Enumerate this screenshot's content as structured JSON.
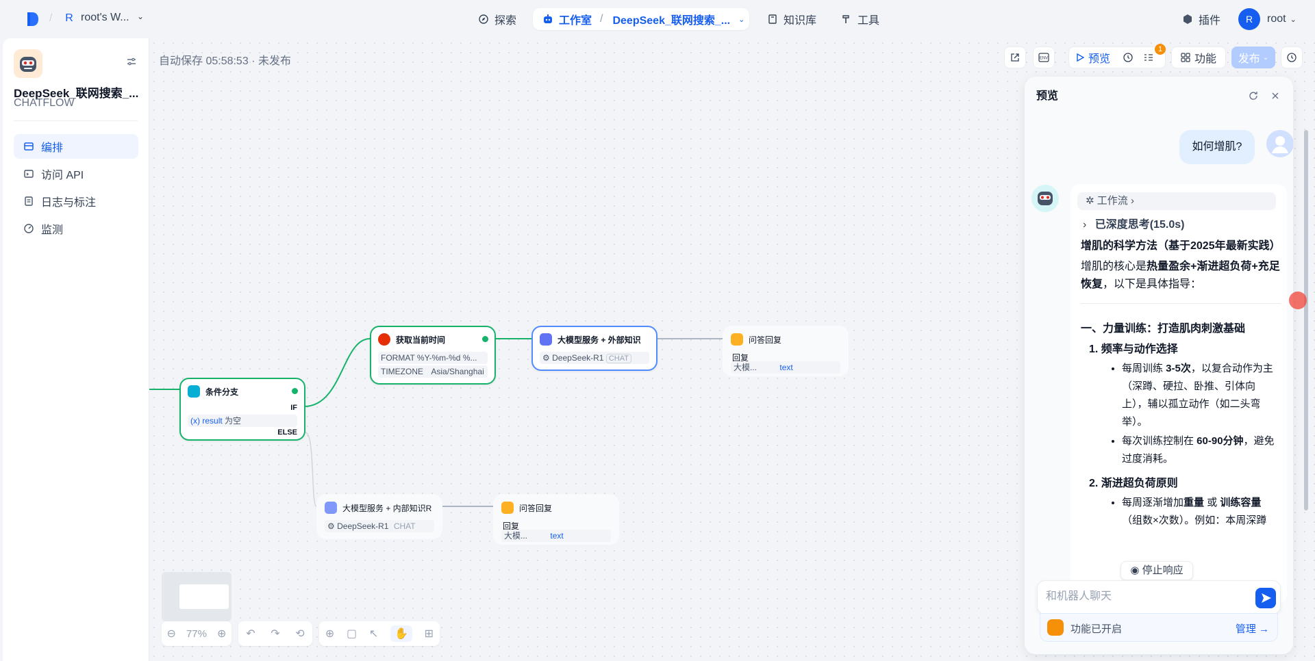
{
  "header": {
    "workspace_initial": "R",
    "workspace_name": "root's W...",
    "nav": {
      "explore": "探索",
      "studio": "工作室",
      "app_name": "DeepSeek_联网搜索_...",
      "knowledge": "知识库",
      "tools": "工具"
    },
    "plugins": "插件",
    "user_initial": "R",
    "user_name": "root"
  },
  "sidebar": {
    "app_name": "DeepSeek_联网搜索_...",
    "app_type": "CHATFLOW",
    "items": [
      {
        "label": "编排",
        "icon": "layout-icon",
        "active": true
      },
      {
        "label": "访问 API",
        "icon": "terminal-icon",
        "active": false
      },
      {
        "label": "日志与标注",
        "icon": "file-list-icon",
        "active": false
      },
      {
        "label": "监测",
        "icon": "dashboard-icon",
        "active": false
      }
    ]
  },
  "canvas": {
    "autosave": "自动保存 05:58:53 · 未发布",
    "toolbar": {
      "preview": "预览",
      "features": "功能",
      "publish": "发布",
      "checklist_badge": "1"
    },
    "zoom": "77%",
    "nodes": {
      "if_else": {
        "title": "条件分支",
        "if_label": "IF",
        "var": "result",
        "op": "为空",
        "else_label": "ELSE"
      },
      "time": {
        "title": "获取当前时间",
        "format_key": "FORMAT",
        "format_val": "%Y-%m-%d %...",
        "tz_key": "TIMEZONE",
        "tz_val": "Asia/Shanghai"
      },
      "llm_ext": {
        "title": "大模型服务 + 外部知识",
        "model": "DeepSeek-R1",
        "mode": "CHAT"
      },
      "answer1": {
        "title": "问答回复",
        "label": "回复",
        "src": "大模...",
        "var": "text"
      },
      "llm_int": {
        "title": "大模型服务 + 内部知识R",
        "model": "DeepSeek-R1",
        "mode": "CHAT"
      },
      "answer2": {
        "title": "问答回复",
        "label": "回复",
        "src": "大模...",
        "var": "text"
      }
    }
  },
  "preview": {
    "title": "预览",
    "user_message": "如何增肌?",
    "workflow_label": "工作流",
    "thinking": "已深度思考(15.0s)",
    "heading": "增肌的科学方法（基于2025年最新实践）",
    "intro_prefix": "增肌的核心是",
    "intro_bold": "热量盈余+渐进超负荷+充足恢复",
    "intro_suffix": "，以下是具体指导：",
    "section1": "一、力量训练：打造肌肉刺激基础",
    "sub1": "1. 频率与动作选择",
    "b1_prefix": "每周训练 ",
    "b1_bold": "3-5次",
    "b1_suffix": "，以复合动作为主（深蹲、硬拉、卧推、引体向上），辅以孤立动作（如二头弯举）。",
    "b2_prefix": "每次训练控制在 ",
    "b2_bold": "60-90分钟",
    "b2_suffix": "，避免过度消耗。",
    "sub2": "2. 渐进超负荷原则",
    "b3_prefix": "每周逐渐增加",
    "b3_bold1": "重量",
    "b3_mid": " 或 ",
    "b3_bold2": "训练容量",
    "b3_suffix": "（组数×次数）。例如：本周深蹲",
    "stop": "停止响应",
    "input_placeholder": "和机器人聊天",
    "features_on": "功能已开启",
    "manage": "管理"
  },
  "colors": {
    "accent": "#155eef",
    "success": "#17b26a",
    "node_border_selected": "#528bff",
    "publish_disabled": "#b2ccff"
  }
}
